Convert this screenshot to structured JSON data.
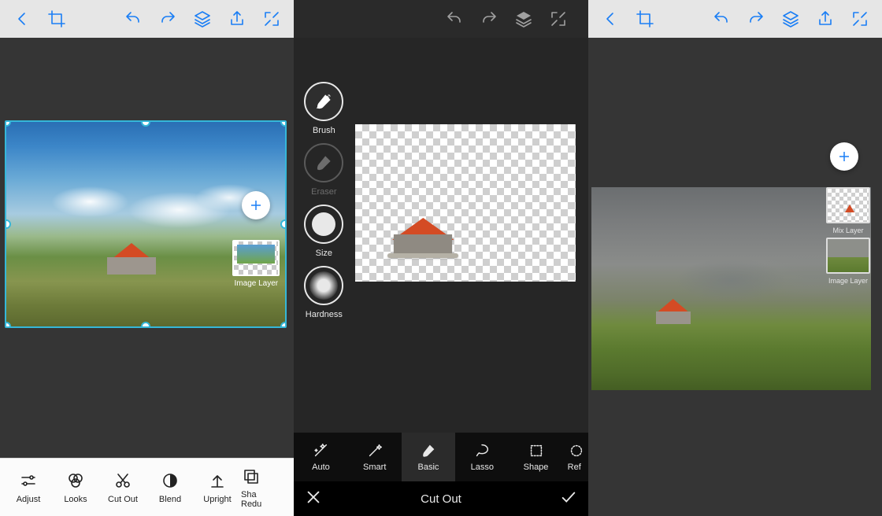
{
  "panel1": {
    "toolbar_icons": [
      "back",
      "crop",
      "undo",
      "redo",
      "layers",
      "share",
      "fullscreen"
    ],
    "thumb_label": "Image Layer",
    "bottom": {
      "adjust": "Adjust",
      "looks": "Looks",
      "cutout": "Cut Out",
      "blend": "Blend",
      "upright": "Upright",
      "shadow_line1": "Sha",
      "shadow_line2": "Redu"
    }
  },
  "panel2": {
    "toolbar_icons": [
      "undo",
      "redo",
      "layers",
      "fullscreen"
    ],
    "tools": {
      "brush": "Brush",
      "eraser": "Eraser",
      "size": "Size",
      "hardness": "Hardness"
    },
    "tabs": {
      "auto": "Auto",
      "smart": "Smart",
      "basic": "Basic",
      "lasso": "Lasso",
      "shape": "Shape",
      "refine": "Ref"
    },
    "title": "Cut Out"
  },
  "panel3": {
    "toolbar_icons": [
      "back",
      "crop",
      "undo",
      "redo",
      "layers",
      "share",
      "fullscreen"
    ],
    "layers": {
      "mix": "Mix Layer",
      "image": "Image Layer"
    }
  }
}
